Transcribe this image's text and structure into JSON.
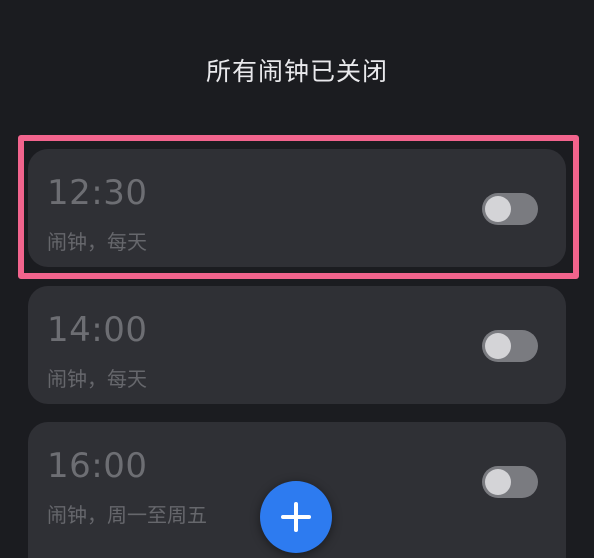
{
  "header": {
    "title": "所有闹钟已关闭"
  },
  "alarms": [
    {
      "time": "12:30",
      "label": "闹钟，每天",
      "enabled": false
    },
    {
      "time": "14:00",
      "label": "闹钟，每天",
      "enabled": false
    },
    {
      "time": "16:00",
      "label": "闹钟，周一至周五",
      "enabled": false
    }
  ],
  "colors": {
    "background": "#1b1c20",
    "card": "#2f3035",
    "highlight": "#f2648d",
    "fab": "#2d7bf0"
  },
  "icons": {
    "fab": "plus-icon"
  }
}
